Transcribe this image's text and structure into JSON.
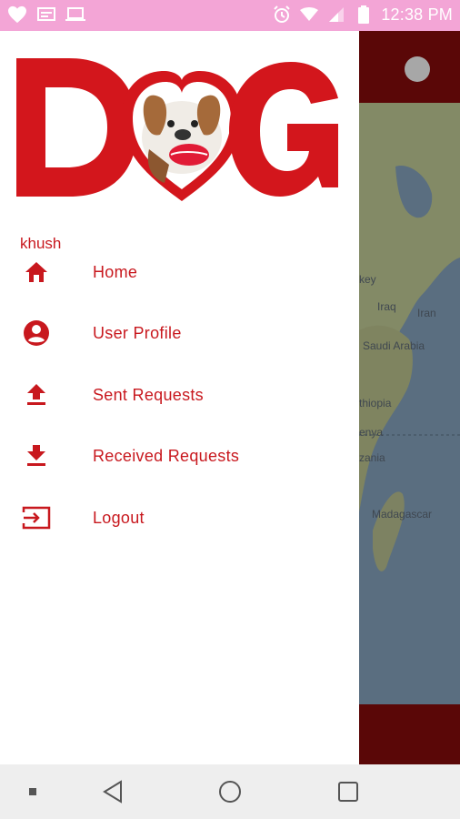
{
  "status_bar": {
    "time": "12:38 PM",
    "left_icons": [
      "heart-icon",
      "sms-icon",
      "laptop-icon"
    ],
    "right_icons": [
      "alarm-icon",
      "wifi-icon",
      "signal-icon",
      "battery-icon"
    ],
    "color": "#f3a5d6"
  },
  "drawer": {
    "logo_text": "DOG",
    "username": "khush",
    "accent_color": "#c8181e",
    "items": [
      {
        "label": "Home",
        "icon": "home-icon"
      },
      {
        "label": "User Profile",
        "icon": "account-circle-icon"
      },
      {
        "label": "Sent Requests",
        "icon": "upload-icon"
      },
      {
        "label": "Received Requests",
        "icon": "download-icon"
      },
      {
        "label": "Logout",
        "icon": "logout-icon"
      }
    ]
  },
  "background_map": {
    "labels": [
      "key",
      "Iraq",
      "Iran",
      "Saudi Arabia",
      "thiopia",
      "enya",
      "zania",
      "Madagascar"
    ]
  },
  "nav_bar": {
    "buttons": [
      "menu-dot-icon",
      "back-icon",
      "home-circle-icon",
      "recents-icon"
    ]
  }
}
